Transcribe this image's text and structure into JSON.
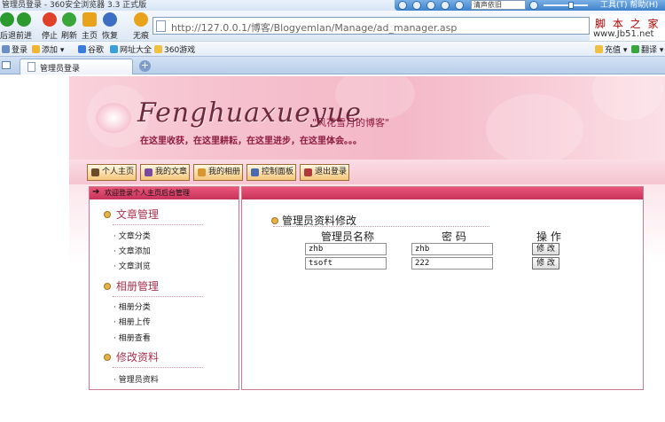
{
  "browser": {
    "window_title": "管理员登录 - 360安全浏览器 3.3 正式版",
    "media": {
      "song": "清声依旧",
      "top_right": "工具(T) 帮助(H)"
    },
    "toolbar": [
      {
        "id": "back",
        "label": "后退",
        "icon": "back-arrow-icon",
        "color": "#2d9a2f"
      },
      {
        "id": "forward",
        "label": "前进",
        "icon": "forward-arrow-icon",
        "color": "#2d9a2f"
      },
      {
        "id": "stop",
        "label": "停止",
        "icon": "stop-icon",
        "color": "#e0412a"
      },
      {
        "id": "refresh",
        "label": "刷新",
        "icon": "refresh-icon",
        "color": "#3aa53a"
      },
      {
        "id": "home",
        "label": "主页",
        "icon": "home-icon",
        "color": "#e8a21c"
      },
      {
        "id": "restore",
        "label": "恢复",
        "icon": "restore-icon",
        "color": "#3c6fc4"
      },
      {
        "id": "traceless",
        "label": "无痕",
        "icon": "traceless-icon",
        "color": "#e8a21c"
      }
    ],
    "address": "http://127.0.0.1/博客/Blogyemlan/Manage/ad_manager.asp",
    "side_hint": {
      "line1": "脚 本 之 家",
      "line2": "www.Jb51.net"
    },
    "favorites": [
      {
        "label": "登录",
        "icon": "user-icon",
        "color": "#6a8fc7"
      },
      {
        "label": "添加",
        "icon": "star-add-icon",
        "color": "#f2b531"
      },
      {
        "label": "谷歌",
        "icon": "google-icon",
        "color": "#3a7be0"
      },
      {
        "label": "网址大全",
        "icon": "globe-icon",
        "color": "#3aa0d8"
      },
      {
        "label": "360游戏",
        "icon": "folder-icon",
        "color": "#f0c040"
      }
    ],
    "fav_right": [
      {
        "label": "充值",
        "icon": "folder-icon",
        "color": "#f0c040"
      },
      {
        "label": "翻译",
        "icon": "translate-icon",
        "color": "#3aa53a"
      }
    ],
    "tab_title": "管理员登录",
    "new_tab": "+"
  },
  "site": {
    "logo": "Fenghuaxueyue",
    "logo_cn": "\"风花雪月的博客\"",
    "slogan": "在这里收获，在这里耕耘，在这里进步，在这里体会。。。",
    "nav": [
      {
        "label": "个人主页",
        "icon": "house-icon",
        "color": "#6b4a2b"
      },
      {
        "label": "我的文章",
        "icon": "article-icon",
        "color": "#7a4aa0"
      },
      {
        "label": "我的相册",
        "icon": "album-icon",
        "color": "#d9952f"
      },
      {
        "label": "控制面板",
        "icon": "panel-icon",
        "color": "#4a6ab0"
      },
      {
        "label": "退出登录",
        "icon": "logout-icon",
        "color": "#b03a3a"
      }
    ]
  },
  "sidebar": {
    "header": "欢迎登录个人主页后台管理",
    "sections": [
      {
        "title": "文章管理",
        "items": [
          "文章分类",
          "文章添加",
          "文章浏览"
        ]
      },
      {
        "title": "相册管理",
        "items": [
          "相册分类",
          "相册上传",
          "相册查看"
        ]
      },
      {
        "title": "修改资料",
        "items": [
          "管理员资料"
        ]
      }
    ]
  },
  "main": {
    "form_title": "管理员资料修改",
    "columns": {
      "name": "管理员名称",
      "password": "密 码",
      "action": "操 作"
    },
    "rows": [
      {
        "name": "zhb",
        "password": "zhb",
        "action": "修 改"
      },
      {
        "name": "tsoft",
        "password": "222",
        "action": "修 改"
      }
    ]
  }
}
